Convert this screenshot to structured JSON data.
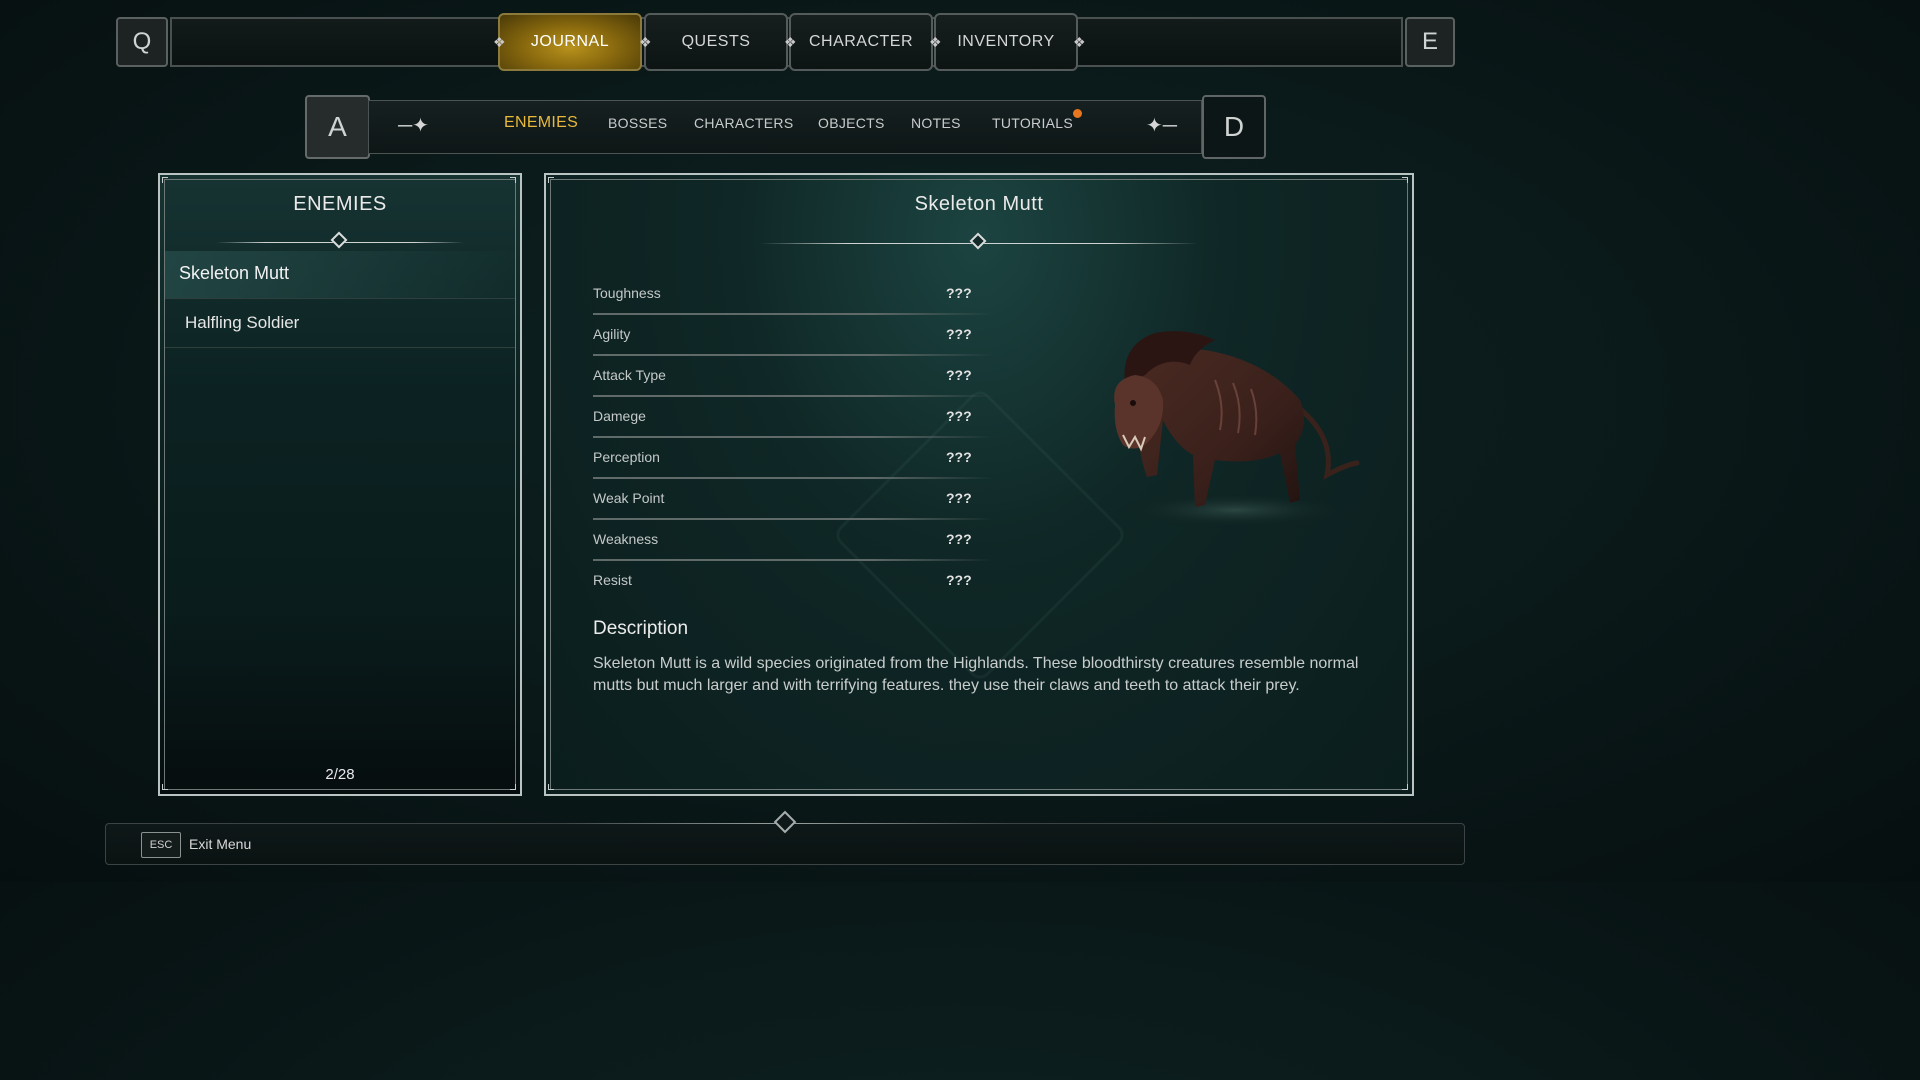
{
  "top_nav": {
    "left_key": "Q",
    "right_key": "E",
    "tabs": [
      {
        "label": "JOURNAL",
        "active": true
      },
      {
        "label": "QUESTS",
        "active": false
      },
      {
        "label": "CHARACTER",
        "active": false
      },
      {
        "label": "INVENTORY",
        "active": false
      }
    ]
  },
  "sub_nav": {
    "left_key": "A",
    "right_key": "D",
    "tabs": [
      {
        "label": "ENEMIES",
        "active": true
      },
      {
        "label": "BOSSES",
        "active": false
      },
      {
        "label": "CHARACTERS",
        "active": false
      },
      {
        "label": "OBJECTS",
        "active": false
      },
      {
        "label": "NOTES",
        "active": false
      },
      {
        "label": "TUTORIALS",
        "active": false,
        "notification": true
      }
    ]
  },
  "enemy_list": {
    "title": "ENEMIES",
    "items": [
      {
        "name": "Skeleton Mutt",
        "selected": true
      },
      {
        "name": "Halfling Soldier",
        "selected": false
      }
    ],
    "counter": "2/28"
  },
  "detail": {
    "name": "Skeleton Mutt",
    "stats": [
      {
        "label": "Toughness",
        "value": "???"
      },
      {
        "label": "Agility",
        "value": "???"
      },
      {
        "label": "Attack Type",
        "value": "???"
      },
      {
        "label": "Damege",
        "value": "???"
      },
      {
        "label": "Perception",
        "value": "???"
      },
      {
        "label": "Weak Point",
        "value": "???"
      },
      {
        "label": "Weakness",
        "value": "???"
      },
      {
        "label": "Resist",
        "value": "???"
      }
    ],
    "description_title": "Description",
    "description": "Skeleton Mutt is a wild species originated from the Highlands. These bloodthirsty creatures resemble normal mutts but much larger and with terrifying features. they use their claws and teeth to attack their prey."
  },
  "footer": {
    "key": "ESC",
    "label": "Exit Menu"
  },
  "colors": {
    "accent_gold": "#e8b93a",
    "active_tab_gold": "#b8921c",
    "notification_dot": "#e8761e",
    "panel_teal": "#163332"
  }
}
